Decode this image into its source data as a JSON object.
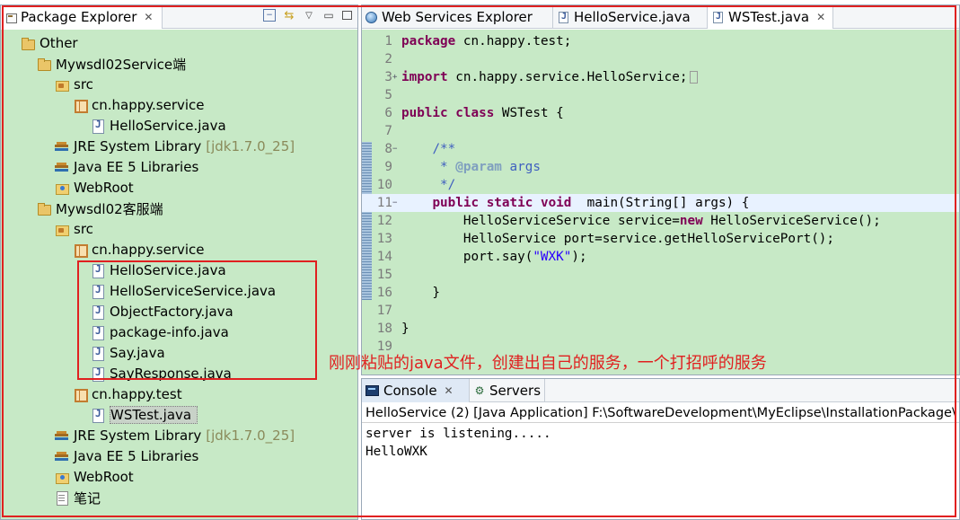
{
  "package_explorer": {
    "tab_title": "Package Explorer",
    "tab_close": "✕",
    "toolbar_icons": [
      "collapse-all-icon",
      "link-with-editor-icon",
      "view-menu-icon",
      "minimize-icon",
      "maximize-icon"
    ],
    "tree": [
      {
        "label": "Other",
        "icon": "project-icon"
      },
      {
        "label": "Mywsdl02Service端",
        "icon": "project-icon"
      },
      {
        "label": "src",
        "icon": "src-folder-icon"
      },
      {
        "label": "cn.happy.service",
        "icon": "package-icon"
      },
      {
        "label": "HelloService.java",
        "icon": "java-file-icon"
      },
      {
        "label": "JRE System Library",
        "decoration": "[jdk1.7.0_25]",
        "icon": "library-icon"
      },
      {
        "label": "Java EE 5 Libraries",
        "icon": "library-icon"
      },
      {
        "label": "WebRoot",
        "icon": "webroot-folder-icon"
      },
      {
        "label": "Mywsdl02客服端",
        "icon": "project-icon"
      },
      {
        "label": "src",
        "icon": "src-folder-icon"
      },
      {
        "label": "cn.happy.service",
        "icon": "package-icon"
      },
      {
        "label": "HelloService.java",
        "icon": "java-file-icon"
      },
      {
        "label": "HelloServiceService.java",
        "icon": "java-file-icon"
      },
      {
        "label": "ObjectFactory.java",
        "icon": "java-file-icon"
      },
      {
        "label": "package-info.java",
        "icon": "java-file-icon"
      },
      {
        "label": "Say.java",
        "icon": "java-file-icon"
      },
      {
        "label": "SayResponse.java",
        "icon": "java-file-icon"
      },
      {
        "label": "cn.happy.test",
        "icon": "package-icon"
      },
      {
        "label": "WSTest.java",
        "icon": "java-file-icon",
        "selected": true
      },
      {
        "label": "JRE System Library",
        "decoration": "[jdk1.7.0_25]",
        "icon": "library-icon"
      },
      {
        "label": "Java EE 5 Libraries",
        "icon": "library-icon"
      },
      {
        "label": "WebRoot",
        "icon": "webroot-folder-icon"
      },
      {
        "label": "笔记",
        "icon": "document-icon"
      }
    ]
  },
  "editor": {
    "tabs": [
      {
        "label": "Web Services Explorer",
        "icon": "globe-icon"
      },
      {
        "label": "HelloService.java",
        "icon": "java-file-icon"
      },
      {
        "label": "WSTest.java",
        "icon": "java-file-icon",
        "active": true,
        "close": "✕"
      }
    ],
    "lines": [
      {
        "n": "1",
        "html": "<span class=\"kw\">package</span> cn.happy.test;"
      },
      {
        "n": "2",
        "html": ""
      },
      {
        "n": "3",
        "fold": "+",
        "html": "<span class=\"kw\">import</span> cn.happy.service.HelloService;<span class=\"collapsed-box\"></span>"
      },
      {
        "n": "5",
        "html": ""
      },
      {
        "n": "6",
        "html": "<span class=\"kw\">public</span> <span class=\"kw\">class</span> WSTest {"
      },
      {
        "n": "7",
        "html": ""
      },
      {
        "n": "8",
        "fold": "−",
        "html": "    <span class=\"cm\">/**</span>"
      },
      {
        "n": "9",
        "html": "     <span class=\"cm\">* </span><span class=\"an\">@param</span><span class=\"cm\"> args</span>"
      },
      {
        "n": "10",
        "html": "     <span class=\"cm\">*/</span>"
      },
      {
        "n": "11",
        "fold": "−",
        "hl": true,
        "html": "    <span class=\"kw\">public</span> <span class=\"kw\">static</span> <span class=\"kw\">void</span>  main(String[] args) {"
      },
      {
        "n": "12",
        "html": "        HelloServiceService service=<span class=\"kw\">new</span> HelloServiceService();"
      },
      {
        "n": "13",
        "html": "        HelloService port=service.getHelloServicePort();"
      },
      {
        "n": "14",
        "html": "        port.say(<span class=\"st\">\"WXK\"</span>);"
      },
      {
        "n": "15",
        "html": ""
      },
      {
        "n": "16",
        "html": "    }"
      },
      {
        "n": "17",
        "html": ""
      },
      {
        "n": "18",
        "html": "}"
      },
      {
        "n": "19",
        "html": ""
      }
    ]
  },
  "console": {
    "tabs": [
      {
        "label": "Console",
        "icon": "console-icon",
        "active": true,
        "close": "✕"
      },
      {
        "label": "Servers",
        "icon": "servers-icon"
      }
    ],
    "header": "HelloService (2) [Java Application] F:\\SoftwareDevelopment\\MyEclipse\\InstallationPackage\\",
    "output": [
      "server is listening.....",
      "HelloWXK"
    ]
  },
  "annotation": {
    "text": "刚刚粘贴的java文件，创建出自己的服务，一个打招呼的服务",
    "color": "#e02020"
  }
}
